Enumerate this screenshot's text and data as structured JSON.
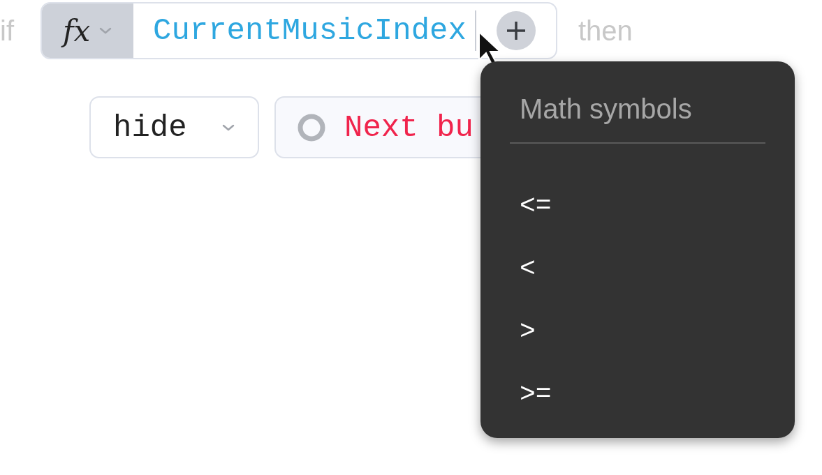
{
  "condition": {
    "prefix": "if",
    "function_label": "fx",
    "expression": "CurrentMusicIndex",
    "suffix": "then"
  },
  "action": {
    "verb": "hide",
    "target": "Next bu"
  },
  "menu": {
    "title": "Math symbols",
    "items": [
      {
        "label": "<="
      },
      {
        "label": "<"
      },
      {
        "label": ">"
      },
      {
        "label": ">="
      }
    ]
  }
}
